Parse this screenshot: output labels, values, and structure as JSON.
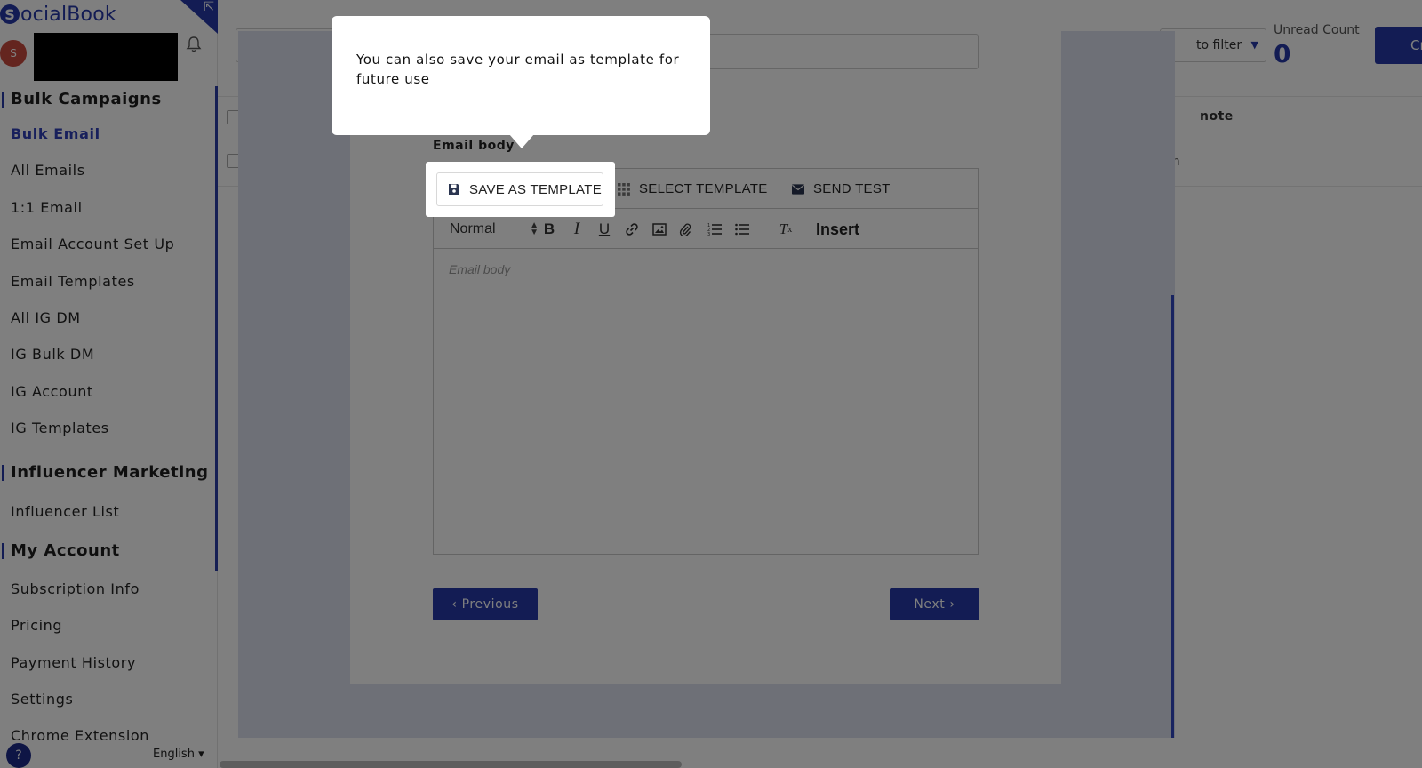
{
  "brand": {
    "name": "ocialBook",
    "mark": "S"
  },
  "user": {
    "avatar_initial": "S"
  },
  "sidebar": {
    "sections": [
      {
        "title": "Bulk Campaigns",
        "items": [
          "Bulk Email",
          "All Emails",
          "1:1 Email",
          "Email Account Set Up",
          "Email Templates",
          "All IG DM",
          "IG Bulk DM",
          "IG Account",
          "IG Templates"
        ]
      },
      {
        "title": "Influencer Marketing",
        "items": [
          "Influencer List"
        ]
      },
      {
        "title": "My Account",
        "items": [
          "Subscription Info",
          "Pricing",
          "Payment History",
          "Settings",
          "Chrome Extension"
        ]
      }
    ],
    "active_item": "Bulk Email",
    "language": "English ▾",
    "help": "?"
  },
  "main": {
    "filter_text": "to filter",
    "unread_label": "Unread Count",
    "unread_value": "0",
    "create_label": "Cr",
    "table_header_note": "note",
    "row_note": "gn"
  },
  "modal": {
    "body_label": "Email body",
    "template_bar": {
      "save": "SAVE AS TEMPLATE",
      "select": "SELECT TEMPLATE",
      "send_test": "SEND TEST"
    },
    "toolbar": {
      "format": "Normal",
      "insert": "Insert"
    },
    "editor_placeholder": "Email body",
    "previous": "‹ Previous",
    "next": "Next ›"
  },
  "tour": {
    "text": "You can also save your email as template for future use"
  },
  "colors": {
    "brand": "#2639a8",
    "avatar": "#c94a3e"
  }
}
